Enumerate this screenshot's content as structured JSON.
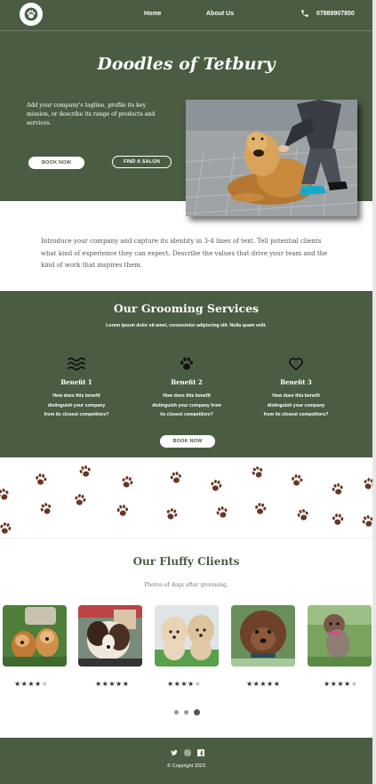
{
  "header": {
    "logo_icon": "paw-icon",
    "nav": [
      {
        "label": "Home"
      },
      {
        "label": "About Us"
      }
    ],
    "phone_icon": "phone-icon",
    "phone": "07889907850"
  },
  "hero": {
    "title": "Doodles of Tetbury",
    "tagline": "Add your company's tagline, profile its key mission, or describe its range of products and services.",
    "book_label": "BOOK NOW",
    "salon_label": "FIND A SALON",
    "photo": "golden-retriever-with-owner-photo"
  },
  "intro": "Introduce your company and capture its identity in 3-4 lines of text. Tell potential clients what kind of experience they can expect. Describe the values that drive your team and the kind of work that inspires them.",
  "services": {
    "title": "Our Grooming Services",
    "subtitle": "Lorem ipsum dolor sit amet, consectetur adipiscing elit. Nulla quam velit.",
    "benefits": [
      {
        "icon": "waves-icon",
        "title": "Benefit 1",
        "desc_lines": [
          "How does this benefit",
          "distinguish your company",
          "from its closest competitors?"
        ]
      },
      {
        "icon": "paw-icon",
        "title": "Benefit 2",
        "desc_lines": [
          "How does this benefit",
          "distinguish your company from",
          "its closest competitors?"
        ]
      },
      {
        "icon": "heart-icon",
        "title": "Benefit 3",
        "desc_lines": [
          "How does this benefit",
          "distinguish your company",
          "from its closest competitors?"
        ]
      }
    ],
    "book_label": "BOOK NOW"
  },
  "clients": {
    "title": "Our Fluffy Clients",
    "subtitle": "Photos of dogs after grooming.",
    "cards": [
      {
        "photo": "two-dogs-photo",
        "rating": 4
      },
      {
        "photo": "bernese-doodle-photo",
        "rating": 5
      },
      {
        "photo": "two-cream-doodles-photo",
        "rating": 4
      },
      {
        "photo": "brown-doodle-photo",
        "rating": 5
      },
      {
        "photo": "grey-doodle-photo",
        "rating": 4
      }
    ],
    "pagination": {
      "pages": 3,
      "current": 3
    }
  },
  "footer": {
    "social": [
      "twitter-icon",
      "instagram-icon",
      "facebook-icon"
    ],
    "copyright": "© Copyright 2023"
  },
  "colors": {
    "brand_green": "#4a5d42",
    "paw_brown": "#6b3524",
    "text_grey": "#555555"
  }
}
